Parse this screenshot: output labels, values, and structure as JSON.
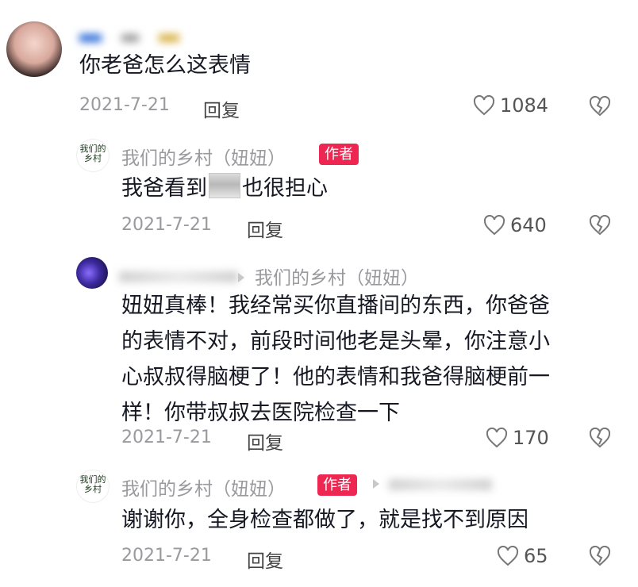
{
  "comments": [
    {
      "username_label": "你老爸怎么这表情",
      "text": "你老爸怎么这表情",
      "date": "2021-7-21",
      "reply_label": "回复",
      "likes": "1084"
    }
  ],
  "replies": [
    {
      "username": "我们的乡村（妞妞）",
      "badge": "作者",
      "text_before_image": "我爸看到",
      "text_after_image": "也很担心",
      "date": "2021-7-21",
      "reply_label": "回复",
      "likes": "640"
    },
    {
      "reply_to": "我们的乡村（妞妞）",
      "text_line1": "妞妞真棒！我经常买你直播间的东西，你爸爸",
      "text_line2": "的表情不对，前段时间他老是头晕，你注意小",
      "text_line3": "心叔叔得脑梗了！他的表情和我爸得脑梗前一",
      "text_line4": "样！你带叔叔去医院检查一下",
      "date": "2021-7-21",
      "reply_label": "回复",
      "likes": "170"
    },
    {
      "username": "我们的乡村（妞妞）",
      "badge": "作者",
      "text": "谢谢你，全身检查都做了，就是找不到原因",
      "date": "2021-7-21",
      "reply_label": "回复",
      "likes": "65"
    }
  ],
  "avatar_logo_text": "我们的乡村",
  "colors": {
    "accent_badge": "#ee2752",
    "text": "#161823",
    "muted": "#9a9a9e"
  },
  "icons": [
    "heart-icon",
    "dislike-icon",
    "reply-arrow-icon"
  ]
}
